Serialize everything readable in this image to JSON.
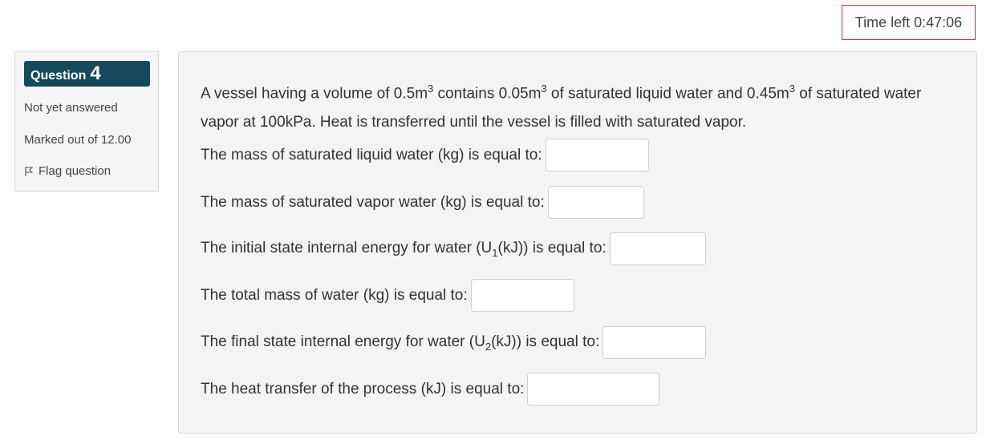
{
  "timer": {
    "label": "Time left",
    "value": "0:47:06"
  },
  "question_info": {
    "question_word": "Question",
    "question_number": "4",
    "status": "Not yet answered",
    "marked_out": "Marked out of 12.00",
    "flag_label": "Flag question"
  },
  "question": {
    "intro_part1": "A vessel having a volume of 0.5m",
    "intro_sup1": "3",
    "intro_part2": " contains 0.05m",
    "intro_sup2": "3",
    "intro_part3": " of saturated liquid water and 0.45m",
    "intro_sup3": "3",
    "intro_part4": " of saturated water vapor at 100kPa. Heat is transferred until the vessel is filled with saturated vapor.",
    "items": [
      {
        "label": "The mass of saturated liquid water (kg) is equal to:",
        "value": ""
      },
      {
        "label": "The mass of saturated vapor water (kg) is equal to:",
        "value": ""
      },
      {
        "label_pre": "The initial state internal energy for water (U",
        "label_sub": "1",
        "label_post": "(kJ)) is equal to:",
        "value": ""
      },
      {
        "label": "The total mass of water (kg) is equal to:",
        "value": ""
      },
      {
        "label_pre": "The final state internal energy for water (U",
        "label_sub": "2",
        "label_post": "(kJ)) is equal to:",
        "value": ""
      },
      {
        "label": "The heat transfer of the process (kJ) is equal to:",
        "value": ""
      }
    ]
  }
}
